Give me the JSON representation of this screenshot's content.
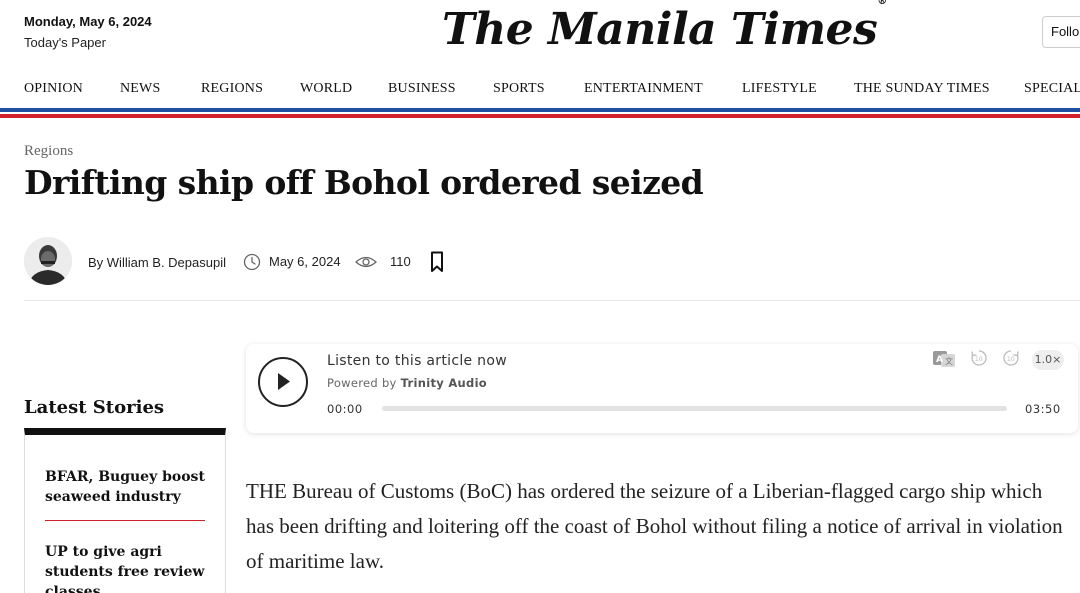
{
  "header": {
    "date": "Monday, May 6, 2024",
    "todays_paper": "Today's Paper",
    "masthead": "The Manila Times",
    "registered_mark": "®",
    "follow_label": "Follo"
  },
  "nav": {
    "items": [
      "OPINION",
      "NEWS",
      "REGIONS",
      "WORLD",
      "BUSINESS",
      "SPORTS",
      "ENTERTAINMENT",
      "LIFESTYLE",
      "THE SUNDAY TIMES",
      "SPECIAL"
    ]
  },
  "brand_colors": {
    "stripe_blue": "#1f4fa0",
    "stripe_red": "#d0202a"
  },
  "article": {
    "category": "Regions",
    "headline": "Drifting ship off Bohol ordered seized",
    "author": "By William B. Depasupil",
    "date": "May 6, 2024",
    "views": "110",
    "icons": [
      "avatar",
      "clock-icon",
      "eye-icon",
      "bookmark-icon"
    ],
    "body": "THE Bureau of Customs (BoC) has ordered the seizure of a Liberian-flagged cargo ship which has been drifting and loitering off the coast of Bohol without filing a notice of arrival in violation of maritime law."
  },
  "player": {
    "title": "Listen to this article now",
    "powered_prefix": "Powered by",
    "powered_brand": "Trinity Audio",
    "current_time": "00:00",
    "total_time": "03:50",
    "progress": 0,
    "speed": "1.0×",
    "icons": [
      "play-icon",
      "translate-icon",
      "rewind-10-icon",
      "forward-10-icon"
    ]
  },
  "sidebar": {
    "title": "Latest Stories",
    "stories": [
      "BFAR, Buguey boost seaweed industry",
      "UP to give agri students free review classes"
    ]
  }
}
